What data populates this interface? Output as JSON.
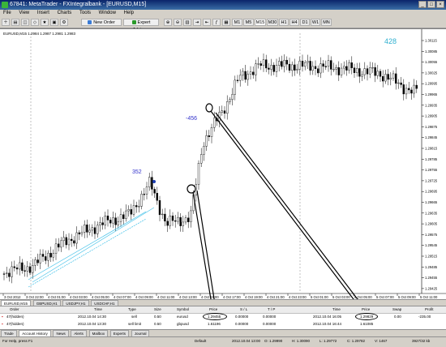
{
  "window": {
    "title": "67841: MetaTrader - FXIntegralbank - [EURUSD,M15]"
  },
  "menu": [
    "File",
    "View",
    "Insert",
    "Charts",
    "Tools",
    "Window",
    "Help"
  ],
  "toolbar": {
    "new_order": "New Order",
    "expert_advisors": "Expert Advisors",
    "periods": [
      "M1",
      "M5",
      "M15",
      "M30",
      "H1",
      "H4",
      "D1",
      "W1",
      "MN"
    ]
  },
  "chart": {
    "info": "EURUSD,M15 1.2984 1.2987 1.2981 1.2983",
    "annotations": {
      "a1": "352",
      "a2": "-456",
      "a3": "428"
    },
    "price_labels": [
      "1.30115",
      "1.30085",
      "1.30055",
      "1.30025",
      "1.29995",
      "1.29965",
      "1.29935",
      "1.29905",
      "1.29875",
      "1.29845",
      "1.29815",
      "1.29785",
      "1.29755",
      "1.29725",
      "1.29695",
      "1.29665",
      "1.29635",
      "1.29605",
      "1.29575",
      "1.29545",
      "1.29515",
      "1.29485",
      "1.29455",
      "1.29425"
    ],
    "time_labels": [
      "3 Oct 2012",
      "3 Oct 22:00",
      "4 Oct 01:00",
      "4 Oct 03:00",
      "4 Oct 05:00",
      "4 Oct 07:00",
      "4 Oct 09:00",
      "4 Oct 11:00",
      "4 Oct 13:00",
      "4 Oct 15:00",
      "4 Oct 17:00",
      "4 Oct 19:00",
      "4 Oct 21:00",
      "4 Oct 23:00",
      "5 Oct 01:00",
      "5 Oct 03:00",
      "5 Oct 05:00",
      "5 Oct 07:00",
      "5 Oct 09:00",
      "5 Oct 11:00"
    ]
  },
  "symbol_tabs": [
    "EURUSD,M15",
    "GBPUSD,H1",
    "USDJPY,H1",
    "USDCHF,H1"
  ],
  "terminal": {
    "headers": [
      "Order",
      "Time",
      "Type",
      "Size",
      "Symbol",
      "Price",
      "S / L",
      "T / P",
      "Time",
      "Price",
      "Swap",
      "Profit"
    ],
    "rows": [
      [
        "47(hidden)",
        "2012.10.04 14:30",
        "sell",
        "0.50",
        "eurusd",
        "1.29455",
        "0.00000",
        "0.00000",
        "2012.10.04 16:05",
        "1.29829",
        "0.00",
        "-235.00"
      ],
      [
        "47(hidden)",
        "2012.10.04 13:30",
        "sell limit",
        "0.50",
        "gbpusd",
        "1.61196",
        "0.00000",
        "0.00000",
        "2012.10.04 16:44",
        "1.61085",
        "",
        ""
      ]
    ]
  },
  "term_tabs": [
    "Trade",
    "Account History",
    "News",
    "Alerts",
    "Mailbox",
    "Experts",
    "Journal"
  ],
  "status": {
    "help": "For Help, press F1",
    "profile": "Default",
    "datetime": "2012.10.04 13:00",
    "open": "O: 1.29990",
    "high": "H: 1.30090",
    "low": "L: 1.29772",
    "close": "C: 1.29782",
    "volume": "V: 1467",
    "traffic": "3927/32 kb"
  }
}
